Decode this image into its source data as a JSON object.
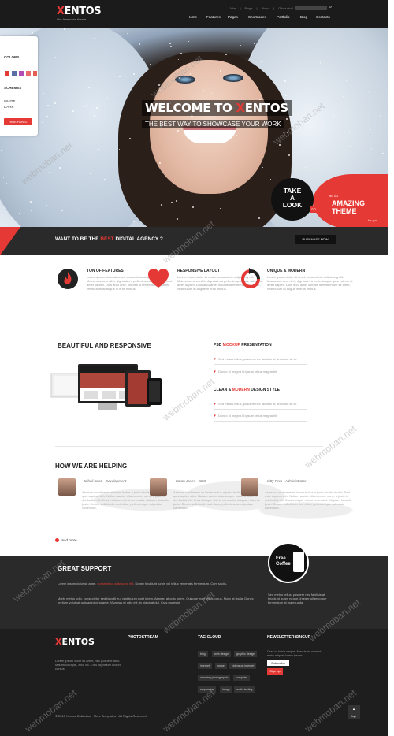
{
  "header": {
    "logo_x": "X",
    "logo_rest": "ENTOS",
    "tagline": "Our Awesome theme",
    "top_links": [
      "Jobs",
      "Blogs",
      "About",
      "Other stuff"
    ],
    "nav": [
      "Home",
      "Features",
      "Pages",
      "Shortcodes",
      "Portfolio",
      "Blog",
      "Contacts"
    ],
    "search_icon": "search-icon"
  },
  "panel": {
    "colors_label": "COLORS",
    "schemes_label": "SCHEMES",
    "scheme_white": "WHITE",
    "scheme_dark": "DARK",
    "hide_label": "HIDE PANEL",
    "swatches": [
      "#e53935",
      "#5b6ea8",
      "#b14db3",
      "#e96b6b",
      "#e45e52"
    ]
  },
  "hero": {
    "welcome_pre": "WELCOME TO ",
    "welcome_x": "X",
    "welcome_post": "ENTOS",
    "subtitle": "THE BEST WAY TO SHOWCASE YOUR WORK",
    "take_look": [
      "TAKE",
      "A",
      "LOOK"
    ],
    "go": "GO",
    "amazing_small": "we do",
    "amazing_big": [
      "AMAZING",
      "THEME"
    ],
    "amazing_for": "for you"
  },
  "agency": {
    "pre": "WANT TO BE THE ",
    "best": "BEST",
    "post": " DIGITAL AGENCY ?",
    "button": "PURCHASE NOW"
  },
  "features": [
    {
      "title": "TON OF FEATURES",
      "body": "Lorem ipsum dolor sit amet, consectetur adipiscing elit. Maecenas sem nibh, dignissim a pellentesque quis, rutrum ut amet sapien. Duis arcu ante, lobortis id fermentum sit amet, vestibulum at augue in eros finibus."
    },
    {
      "title": "RESPONSIVE LAYOUT",
      "body": "Lorem ipsum dolor sit amet, consectetur adipiscing elit. Maecenas sem nibh, dignissim a pellentesque quis, rutrum ut amet sapien. Duis arcu ante, lobortis id fermentum sit amet, vestibulum at augue in eros finibus."
    },
    {
      "title": "UNIQUE & MODERN",
      "body": "Lorem ipsum dolor sit amet, consectetur adipiscing elit. Maecenas sem nibh, dignissim a pellentesque quis, rutrum ut amet sapien. Duis arcu ante, lobortis id fermentum sit amet, vestibulum at augue in eros finibus."
    }
  ],
  "responsive": {
    "title": "BEAUTIFUL AND RESPONSIVE",
    "psd_pre": "PSD ",
    "psd_red": "MOCKUP",
    "psd_post": " PRESENTATION",
    "psd_items": [
      "Sed metus tellus, posuere nec facilisis at, tincidunt sit in.",
      "Donec id magna id ipsum tellus magna hit."
    ],
    "clean_pre": "CLEAN & ",
    "clean_red": "MODERN",
    "clean_post": " DESIGN STYLE",
    "clean_items": [
      "Sed metus tellus, posuere nec facilisis at, tincidunt sit in.",
      "Donec id magna id ipsum tellus magna hit."
    ]
  },
  "helping": {
    "title": "HOW WE ARE HELPING",
    "people": [
      {
        "name": "- Mikail Saez - Development",
        "quote": "Aenean condimentum lorem lectus a justo facilisi facilisi. Sed quis sapien nibh. Nullam auctor ullamcorper nunc, a justo in dui facilisi elit. Cras tristique nisl at venenatis. Aliquam lobortis justo. Donec sollicitudin sed dolor, pellentesque vulputate commodo."
      },
      {
        "name": "- Sarah Jones - SEO",
        "quote": "Aenean condimentum lorem lectus a justo facilisi facilisi. Sed quis sapien nibh. Nullam auctor ullamcorper nunc, a justo in dui facilisi elit. Cras tristique nisl at venenatis. Aliquam lobortis justo. Donec sollicitudin sed dolor, pellentesque vulputate commodo."
      },
      {
        "name": "- Kitty Fern - Administrator",
        "quote": "Aenean condimentum lorem lectus a justo facilisi facilisi. Sed quis sapien nibh. Nullam auctor ullamcorper nunc, a justo in dui facilisi elit. Cras tristique nisl at venenatis. Aliquam lobortis justo. Donec sollicitudin sed dolor, pellentesque vulputate commodo."
      }
    ],
    "read_more": "read more"
  },
  "support": {
    "title": "GREAT SUPPORT",
    "p1_pre": "Lorem ipsum dolor sit amet, ",
    "p1_red": "consectetur adipiscing elit",
    "p1_post": ". Donec tincidunt turpis vel tellus venenatis fermentum. Cum sociis.",
    "p2": "Morbi metus odio, consectetur sed blandit eu, vestibulum eget lorem. Aenean at odio lorem. Quisque eget tellus purus. Nunc at ligula. Donec pretium volutpat quis adipiscing ante. Vivamus et odio elit, in placerat dui. Cras molestie.",
    "coffee": [
      "Free",
      "Coffee"
    ],
    "coffee_text": "Sed metus tellus, posuere nec facilisis at tincidunt quam neque, integer ullamcorper fermentum at malesuada."
  },
  "footer": {
    "logo_x": "X",
    "logo_rest": "ENTOS",
    "about": "Lorem ipsum dolor sit amet, nec posuere arcu. Mauris volutpat, arcu mi. Cras dignissim dictum cursus.",
    "photostream": "PHOTOSTREAM",
    "tagcloud": "TAG CLOUD",
    "tags": [
      "blog",
      "web design",
      "graphic design",
      "internet",
      "muse",
      "videos on internet",
      "amazing photographic",
      "computer",
      "responsive",
      "image",
      "audio testing"
    ],
    "newsletter": "NEWSLETTER SINGUP",
    "newsletter_text": "Cras id tortor neque. Mauris ac urna ut enim aliquet lorem ipsum.",
    "subscribe": "Subscribe",
    "signin": "Sign up",
    "copyright": "© 2013 Xentos Collection",
    "more": "More Templates",
    "rights": "All Rights Reserved",
    "totop": "top"
  },
  "watermark": "webmoban.net"
}
